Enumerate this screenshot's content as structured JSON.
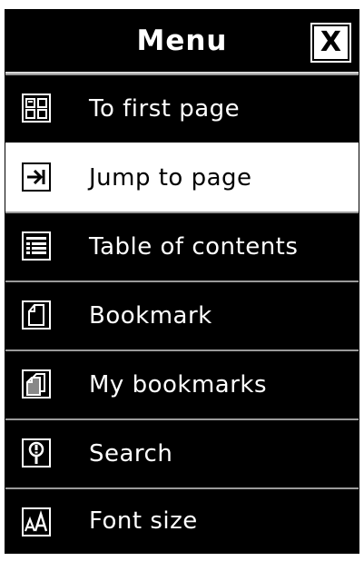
{
  "menu": {
    "title": "Menu",
    "close_label": "X",
    "items": [
      {
        "label": "To first page",
        "icon": "first-page-icon",
        "selected": false
      },
      {
        "label": "Jump to page",
        "icon": "jump-to-page-icon",
        "selected": true
      },
      {
        "label": "Table of contents",
        "icon": "table-of-contents-icon",
        "selected": false
      },
      {
        "label": "Bookmark",
        "icon": "bookmark-icon",
        "selected": false
      },
      {
        "label": "My bookmarks",
        "icon": "my-bookmarks-icon",
        "selected": false
      },
      {
        "label": "Search",
        "icon": "search-icon",
        "selected": false
      },
      {
        "label": "Font size",
        "icon": "font-size-icon",
        "selected": false
      }
    ]
  },
  "colors": {
    "background": "#000000",
    "text": "#ffffff",
    "selected_background": "#ffffff",
    "selected_text": "#000000",
    "separator": "#9a9a9a"
  }
}
